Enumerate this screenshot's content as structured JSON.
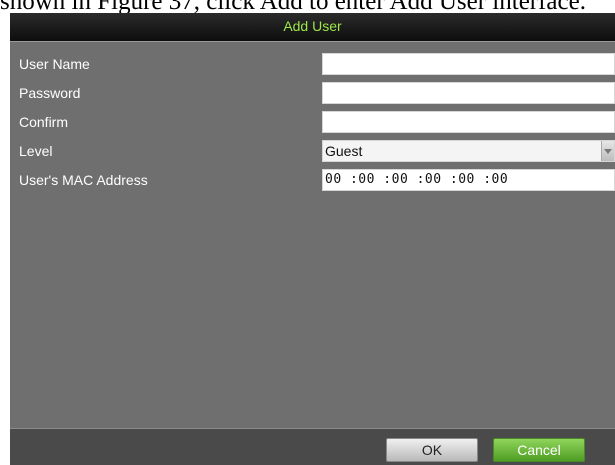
{
  "doc": {
    "text": "shown in Figure 37, click Add to enter Add User interface."
  },
  "dialog": {
    "title": "Add User",
    "fields": {
      "user_name": {
        "label": "User Name",
        "value": ""
      },
      "password": {
        "label": "Password",
        "value": ""
      },
      "confirm": {
        "label": "Confirm",
        "value": ""
      },
      "level": {
        "label": "Level",
        "value": "Guest"
      },
      "mac": {
        "label": "User's MAC Address",
        "value": "00 :00 :00 :00 :00 :00"
      }
    },
    "buttons": {
      "ok": "OK",
      "cancel": "Cancel"
    }
  },
  "colors": {
    "title": "#9fe64a",
    "panel": "#6f6f6f",
    "cancel": "#5cae2e"
  }
}
